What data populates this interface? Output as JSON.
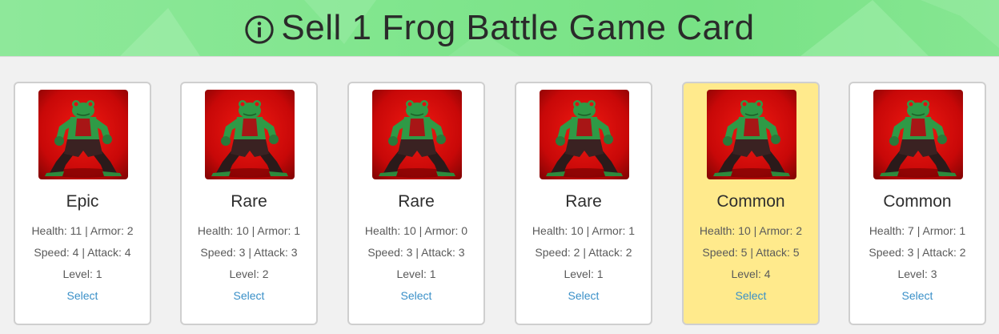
{
  "header": {
    "title": "Sell 1 Frog Battle Game Card",
    "icon": "info-icon",
    "background": "#82e68f"
  },
  "cards": [
    {
      "rarity": "Epic",
      "line1": "Health: 11 | Armor: 2",
      "line2": "Speed: 4 | Attack: 4",
      "line3": "Level: 1",
      "select": "Select",
      "selected": false
    },
    {
      "rarity": "Rare",
      "line1": "Health: 10 | Armor: 1",
      "line2": "Speed: 3 | Attack: 3",
      "line3": "Level: 2",
      "select": "Select",
      "selected": false
    },
    {
      "rarity": "Rare",
      "line1": "Health: 10 | Armor: 0",
      "line2": "Speed: 3 | Attack: 3",
      "line3": "Level: 1",
      "select": "Select",
      "selected": false
    },
    {
      "rarity": "Rare",
      "line1": "Health: 10 | Armor: 1",
      "line2": "Speed: 2 | Attack: 2",
      "line3": "Level: 1",
      "select": "Select",
      "selected": false
    },
    {
      "rarity": "Common",
      "line1": "Health: 10 | Armor: 2",
      "line2": "Speed: 5 | Attack: 5",
      "line3": "Level: 4",
      "select": "Select",
      "selected": true
    },
    {
      "rarity": "Common",
      "line1": "Health: 7 | Armor: 1",
      "line2": "Speed: 3 | Attack: 2",
      "line3": "Level: 3",
      "select": "Select",
      "selected": false
    }
  ],
  "colors": {
    "selected_card": "#ffea8c",
    "link": "#3a90c8",
    "card_art_background": "#d40c0c"
  }
}
